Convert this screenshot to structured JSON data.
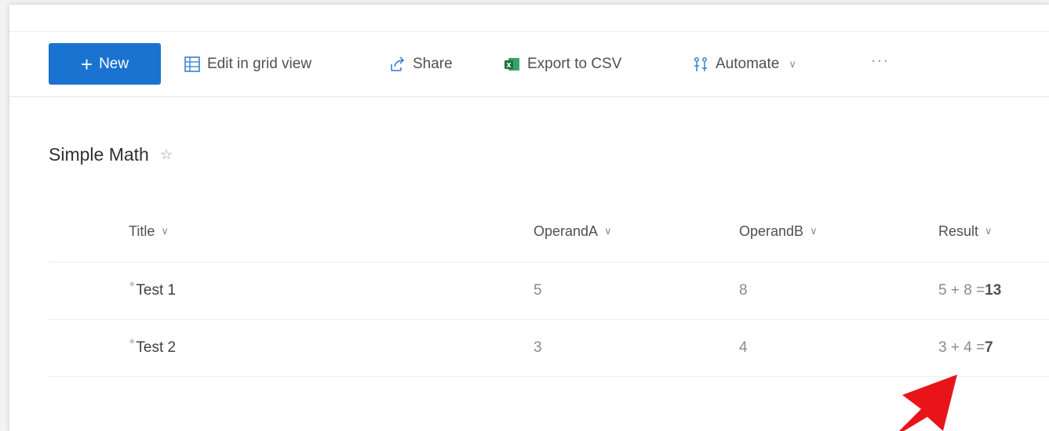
{
  "toolbar": {
    "new_label": "New",
    "edit_grid_label": "Edit in grid view",
    "share_label": "Share",
    "export_label": "Export to CSV",
    "automate_label": "Automate",
    "more_label": "···"
  },
  "list": {
    "title": "Simple Math",
    "columns": [
      "Title",
      "OperandA",
      "OperandB",
      "Result"
    ],
    "rows": [
      {
        "title": "Test 1",
        "a": "5",
        "b": "8",
        "result_expr": "5 + 8 = ",
        "result_value": "13"
      },
      {
        "title": "Test 2",
        "a": "3",
        "b": "4",
        "result_expr": "3 + 4 = ",
        "result_value": "7"
      }
    ]
  },
  "colors": {
    "primary": "#1a73d0",
    "excel_green": "#1e7145",
    "annotation_arrow": "#e8141a"
  },
  "icons": {
    "new": "plus-icon",
    "edit_grid": "grid-icon",
    "share": "share-icon",
    "export": "excel-icon",
    "automate": "automate-icon",
    "favorite": "star-icon",
    "new_item": "new-item-icon",
    "annotation": "red-arrow-icon"
  }
}
